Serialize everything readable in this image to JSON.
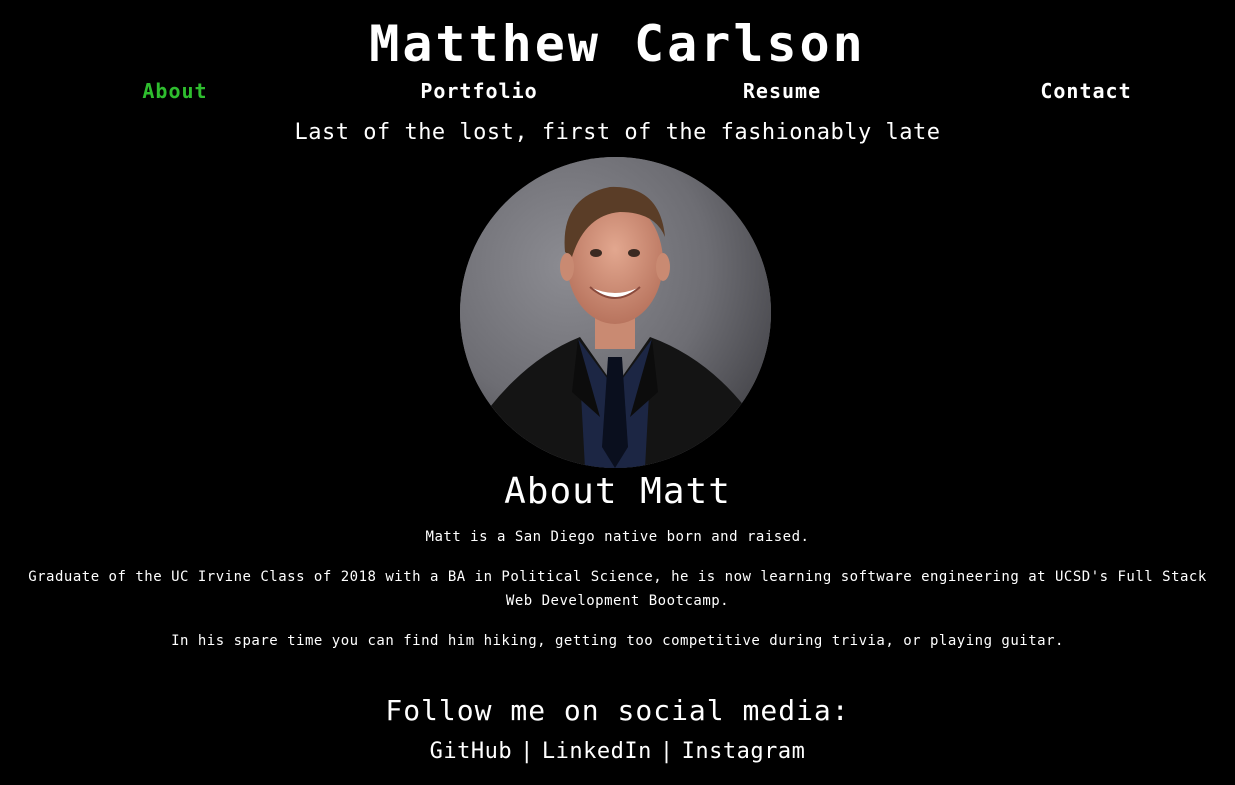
{
  "header": {
    "title": "Matthew Carlson",
    "tagline": "Last of the lost, first of the fashionably late"
  },
  "nav": {
    "items": [
      {
        "label": "About",
        "active": true
      },
      {
        "label": "Portfolio",
        "active": false
      },
      {
        "label": "Resume",
        "active": false
      },
      {
        "label": "Contact",
        "active": false
      }
    ]
  },
  "about": {
    "heading": "About Matt",
    "paragraphs": [
      "Matt is a San Diego native born and raised.",
      "Graduate of the UC Irvine Class of 2018 with a BA in Political Science, he is now learning software engineering at UCSD's Full Stack Web Development Bootcamp.",
      "In his spare time you can find him hiking, getting too competitive during trivia, or playing guitar."
    ]
  },
  "social": {
    "heading": "Follow me on social media:",
    "separator": "|",
    "links": [
      "GitHub",
      "LinkedIn",
      "Instagram"
    ]
  },
  "colors": {
    "background": "#000000",
    "text": "#ffffff",
    "active_nav": "#2ebd2e"
  }
}
